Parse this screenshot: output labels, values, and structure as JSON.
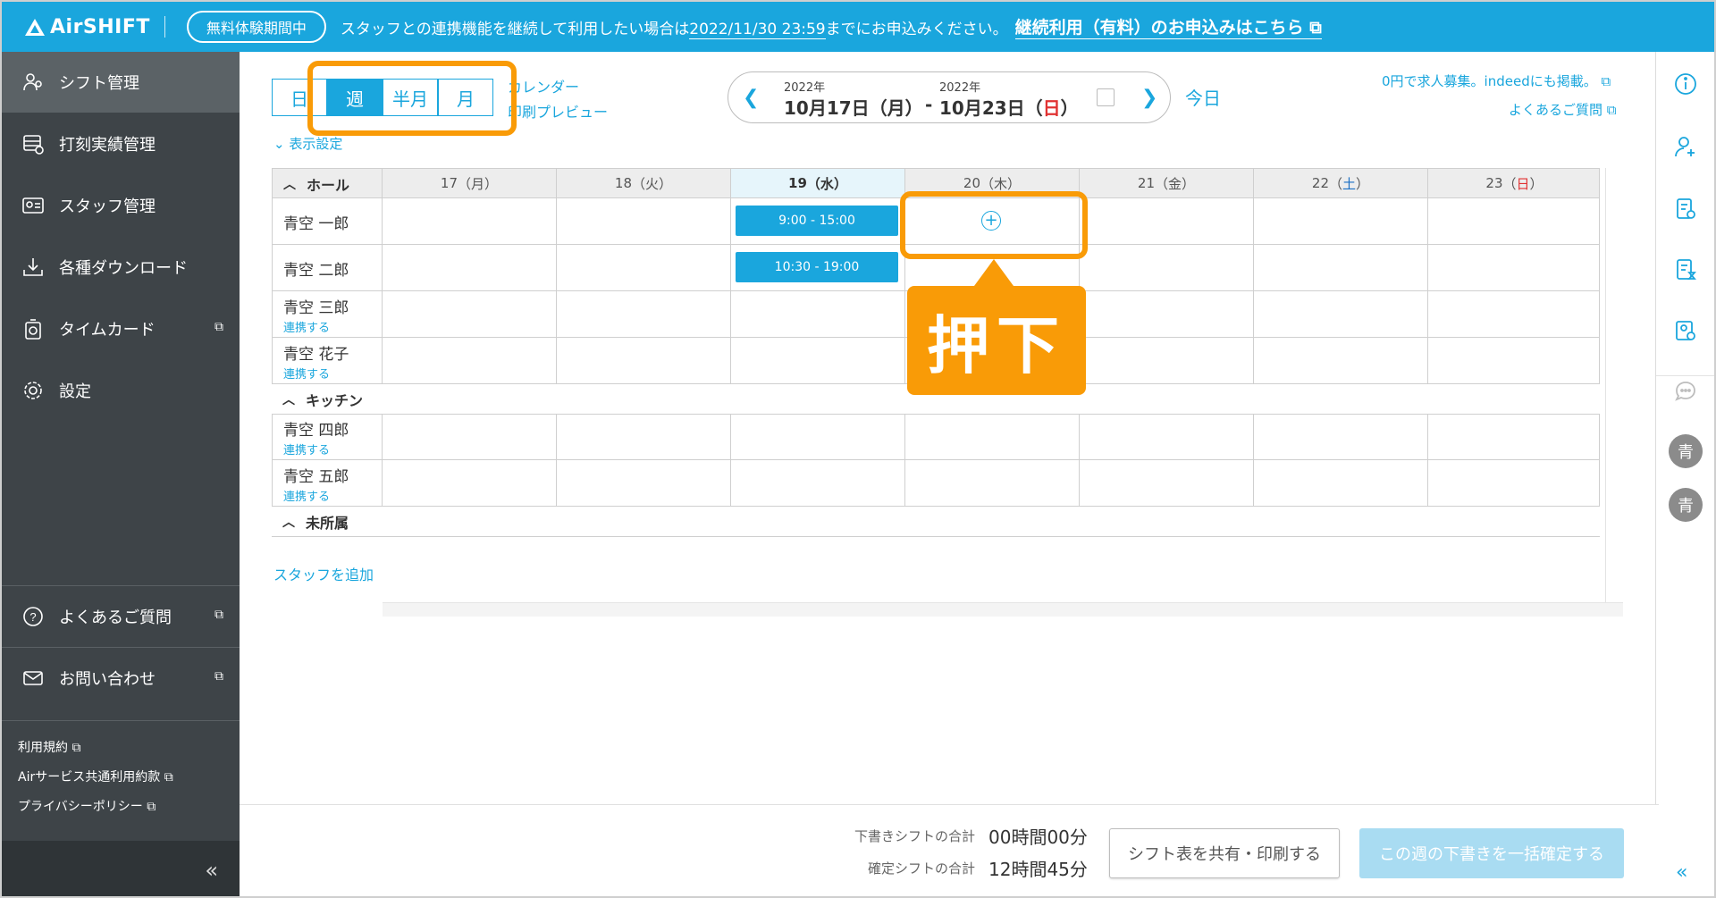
{
  "topbar": {
    "logo_text": "AirSHIFT",
    "trial_badge": "無料体験期間中",
    "notice_prefix": "スタッフとの連携機能を継続して利用したい場合は",
    "notice_deadline": "2022/11/30 23:59",
    "notice_suffix": "までにお申込みください。",
    "notice_link": "継続利用（有料）のお申込みはこちら"
  },
  "sidebar": {
    "items": [
      {
        "label": "シフト管理",
        "icon": "people-gear-icon"
      },
      {
        "label": "打刻実績管理",
        "icon": "timesheet-icon"
      },
      {
        "label": "スタッフ管理",
        "icon": "id-card-icon"
      },
      {
        "label": "各種ダウンロード",
        "icon": "download-icon"
      },
      {
        "label": "タイムカード",
        "icon": "timecard-icon"
      },
      {
        "label": "設定",
        "icon": "gear-icon"
      }
    ],
    "support": [
      {
        "label": "よくあるご質問",
        "icon": "question-icon"
      },
      {
        "label": "お問い合わせ",
        "icon": "mail-icon"
      }
    ],
    "legal": [
      "利用規約",
      "Airサービス共通利用約款",
      "プライバシーポリシー"
    ],
    "collapse": "«"
  },
  "toolbar": {
    "views": [
      "日",
      "週",
      "半月",
      "月"
    ],
    "selected_view": "週",
    "calendar_link": "カレンダー",
    "print_preview": "印刷プレビュー",
    "display_settings": "表示設定",
    "start_year": "2022年",
    "start_date": "10月17日（月）",
    "range_sep": "-",
    "end_year": "2022年",
    "end_date_prefix": "10月23日（",
    "end_date_day": "日",
    "end_date_suffix": "）",
    "today": "今日",
    "indeed_link": "0円で求人募集。indeedにも掲載。",
    "faq_link": "よくあるご質問"
  },
  "grid": {
    "days": [
      {
        "num": "17",
        "dow": "月"
      },
      {
        "num": "18",
        "dow": "火"
      },
      {
        "num": "19",
        "dow": "水"
      },
      {
        "num": "20",
        "dow": "木"
      },
      {
        "num": "21",
        "dow": "金"
      },
      {
        "num": "22",
        "dow": "土"
      },
      {
        "num": "23",
        "dow": "日"
      }
    ],
    "groups": [
      {
        "name": "ホール",
        "staff": [
          {
            "name": "青空 一郎",
            "link": ""
          },
          {
            "name": "青空 二郎",
            "link": ""
          },
          {
            "name": "青空 三郎",
            "link": "連携する"
          },
          {
            "name": "青空 花子",
            "link": "連携する"
          }
        ]
      },
      {
        "name": "キッチン",
        "staff": [
          {
            "name": "青空 四郎",
            "link": "連携する"
          },
          {
            "name": "青空 五郎",
            "link": "連携する"
          }
        ]
      },
      {
        "name": "未所属",
        "staff": []
      }
    ],
    "shifts": [
      {
        "staff": "青空 一郎",
        "day": "19",
        "time": "9:00 - 15:00"
      },
      {
        "staff": "青空 二郎",
        "day": "19",
        "time": "10:30 - 19:00"
      }
    ],
    "add_staff": "スタッフを追加"
  },
  "callout": "押下",
  "footer": {
    "draft_label": "下書きシフトの合計",
    "draft_value": "00時間00分",
    "confirmed_label": "確定シフトの合計",
    "confirmed_value": "12時間45分",
    "share_button": "シフト表を共有・印刷する",
    "confirm_button": "この週の下書きを一括確定する"
  },
  "rail": {
    "avatars": [
      "青",
      "青"
    ],
    "collapse": "«"
  },
  "colors": {
    "brand": "#1aa6dd",
    "sidebar": "#3e4448",
    "highlight": "#f99b07",
    "sunday": "#e13232",
    "saturday": "#1a6fc4"
  }
}
